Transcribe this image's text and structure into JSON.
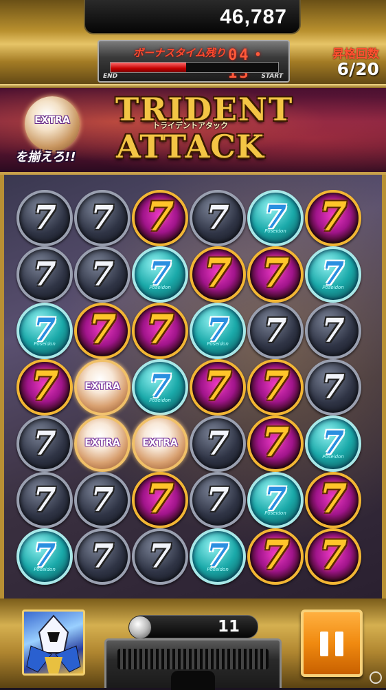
{
  "header": {
    "score": "46,787",
    "bonus_time_label": "ボーナスタイム残り",
    "bonus_time_value": "04・13",
    "bonus_time_progress": 0.45,
    "bar_end_label": "END",
    "bar_start_label": "START",
    "promotion_label": "昇格回数",
    "promotion_value": "6/20"
  },
  "banner": {
    "extra_orb_label": "EXTRA",
    "collect_text": "を揃えろ!!",
    "logo_line1": "TRIDENT",
    "logo_ruby": "トライデントアタック",
    "logo_line2": "ATTACK"
  },
  "board": {
    "glyph": "7",
    "extra_label": "EXTRA",
    "cyan_caption": "Poseidon",
    "rows": [
      [
        "silver",
        "silver",
        "gold",
        "silver",
        "cyan",
        "gold"
      ],
      [
        "silver",
        "silver",
        "cyan",
        "gold",
        "gold",
        "cyan"
      ],
      [
        "cyan",
        "gold",
        "gold",
        "cyan",
        "silver",
        "silver"
      ],
      [
        "gold",
        "extra",
        "cyan",
        "gold",
        "gold",
        "silver"
      ],
      [
        "silver",
        "extra",
        "extra",
        "silver",
        "gold",
        "cyan"
      ],
      [
        "silver",
        "silver",
        "gold",
        "silver",
        "cyan",
        "gold"
      ],
      [
        "cyan",
        "silver",
        "silver",
        "cyan",
        "gold",
        "gold"
      ]
    ]
  },
  "footer": {
    "item_count": "11"
  },
  "colors": {
    "accent_gold": "#d5b050",
    "timer_red": "#ff4a2e",
    "pause_orange": "#f08a10"
  },
  "icons": {
    "pause": "pause-icon",
    "coin": "coin-icon",
    "character": "character-portrait-icon"
  }
}
